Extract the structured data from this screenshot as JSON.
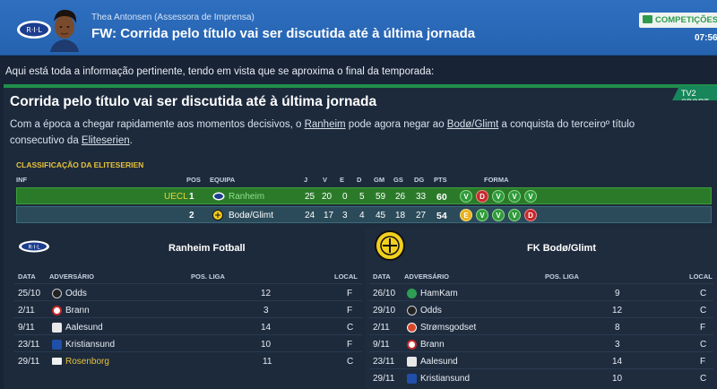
{
  "header": {
    "sender": "Thea Antonsen",
    "sender_role": "(Assessora de Imprensa)",
    "title": "FW: Corrida pelo título vai ser discutida até à última jornada",
    "competitions_label": "COMPETIÇÕES",
    "time": "07:56"
  },
  "intro": "Aqui está toda a informação pertinente, tendo em vista que se aproxima o final da temporada:",
  "article": {
    "source": "TV2 SPORT",
    "title": "Corrida pelo título vai ser discutida até à última jornada",
    "body_part1": "Com a época a chegar rapidamente aos momentos decisivos, o ",
    "team1": "Ranheim",
    "body_part2": " pode agora negar ao ",
    "team2": "Bodø/Glimt",
    "body_part3": " a conquista do terceiroº título consecutivo da ",
    "league": "Eliteserien",
    "body_end": "."
  },
  "standings": {
    "title": "CLASSIFICAÇÃO DA ELITESERIEN",
    "headers": {
      "inf": "INF",
      "pos": "POS",
      "team": "EQUIPA",
      "j": "J",
      "v": "V",
      "e": "E",
      "d": "D",
      "gm": "GM",
      "gs": "GS",
      "dg": "DG",
      "pts": "PTS",
      "form": "FORMA"
    },
    "rows": [
      {
        "inf": "UECL",
        "pos": "1",
        "team": "Ranheim",
        "j": "25",
        "v": "20",
        "e": "0",
        "d": "5",
        "gm": "59",
        "gs": "26",
        "dg": "33",
        "pts": "60",
        "form": [
          "V",
          "D",
          "V",
          "V",
          "V"
        ]
      },
      {
        "inf": "",
        "pos": "2",
        "team": "Bodø/Glimt",
        "j": "24",
        "v": "17",
        "e": "3",
        "d": "4",
        "gm": "45",
        "gs": "18",
        "dg": "27",
        "pts": "54",
        "form": [
          "E",
          "V",
          "V",
          "V",
          "D"
        ]
      }
    ]
  },
  "fixtures_left": {
    "team": "Ranheim Fotball",
    "crest_text": "R·I·L",
    "headers": {
      "date": "DATA",
      "opponent": "ADVERSÁRIO",
      "league_pos": "POS. LIGA",
      "venue": "LOCAL"
    },
    "matches": [
      {
        "date": "25/10",
        "opponent": "Odds",
        "pos": "12",
        "venue": "F"
      },
      {
        "date": "2/11",
        "opponent": "Brann",
        "pos": "3",
        "venue": "F"
      },
      {
        "date": "9/11",
        "opponent": "Aalesund",
        "pos": "14",
        "venue": "C"
      },
      {
        "date": "23/11",
        "opponent": "Kristiansund",
        "pos": "10",
        "venue": "F"
      },
      {
        "date": "29/11",
        "opponent": "Rosenborg",
        "pos": "11",
        "venue": "C"
      }
    ]
  },
  "fixtures_right": {
    "team": "FK Bodø/Glimt",
    "headers": {
      "date": "DATA",
      "opponent": "ADVERSÁRIO",
      "league_pos": "POS. LIGA",
      "venue": "LOCAL"
    },
    "matches": [
      {
        "date": "26/10",
        "opponent": "HamKam",
        "pos": "9",
        "venue": "C"
      },
      {
        "date": "29/10",
        "opponent": "Odds",
        "pos": "12",
        "venue": "C"
      },
      {
        "date": "2/11",
        "opponent": "Strømsgodset",
        "pos": "8",
        "venue": "F"
      },
      {
        "date": "9/11",
        "opponent": "Brann",
        "pos": "3",
        "venue": "C"
      },
      {
        "date": "23/11",
        "opponent": "Aalesund",
        "pos": "14",
        "venue": "F"
      },
      {
        "date": "29/11",
        "opponent": "Kristiansund",
        "pos": "10",
        "venue": "C"
      }
    ]
  },
  "colors": {
    "accent_green": "#1f8f4a",
    "header_blue": "#2f6fc0",
    "highlight_gold": "#e7c23a",
    "link_green": "#8ee08a"
  }
}
